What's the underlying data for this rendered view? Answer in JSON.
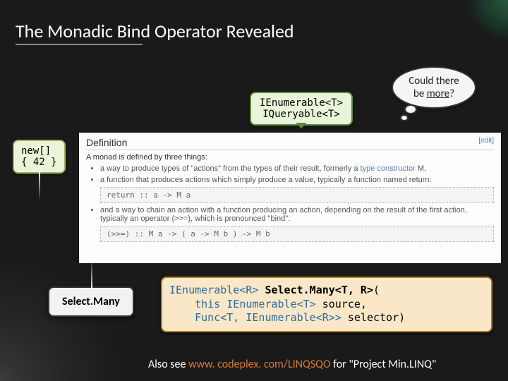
{
  "title": "The Monadic Bind Operator Revealed",
  "thought": {
    "line1": "Could there",
    "line2_prefix": "be ",
    "line2_em": "more",
    "line2_suffix": "?"
  },
  "type_callout": {
    "line1": "IEnumerable<T>",
    "line2": "IQueryable<T>"
  },
  "new_callout": "new[]\n{ 42 }",
  "wiki": {
    "heading": "Definition",
    "edit_label": "[edit]",
    "intro": "A monad is defined by three things:",
    "bullet1_pre": "a way to produce types of \"actions\" from the types of their result, formerly a ",
    "bullet1_link": "type constructor",
    "bullet1_post": " M,",
    "bullet2": "a function that produces actions which simply produce a value, typically a function named return:",
    "code1": "return :: a -> M a",
    "bullet3": "and a way to chain an action with a function producing an action, depending on the result of the first action, typically an operator (>>=), which is pronounced \"bind\":",
    "code2": "(>>=)  :: M a -> ( a -> M b ) -> M b"
  },
  "select_many_label": "Select.Many",
  "code_block": {
    "ret_type": "IEnumerable<R>",
    "method": "Select.Many<T, R>",
    "paren_open": "(",
    "this_kw": "this",
    "src_type": "IEnumerable<T>",
    "src_name": " source,",
    "func_type": "Func<T, IEnumerable<R>>",
    "sel_name": " selector)"
  },
  "footnote": {
    "pre": "Also see ",
    "link": "www. codeplex. com/LINQSQO",
    "post": " for \"Project Min.LINQ\""
  }
}
